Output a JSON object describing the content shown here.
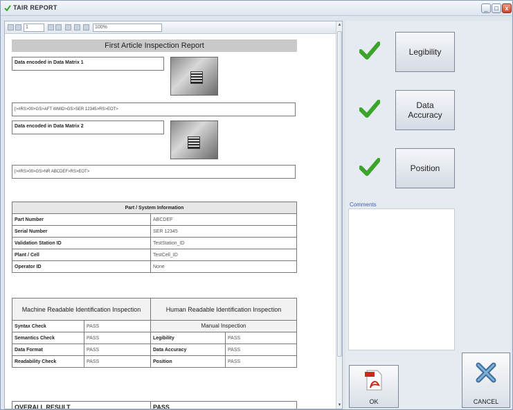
{
  "window": {
    "title": "TAIR REPORT"
  },
  "toolbar": {
    "page_field": "1",
    "zoom_field": "100%"
  },
  "report": {
    "title": "First Article Inspection Report",
    "matrix1": {
      "label": "Data encoded in Data Matrix 1",
      "data": "[>#RS>00>GS>AFT WMID>GS>SER 12345>RS>EOT>"
    },
    "matrix2": {
      "label": "Data encoded in Data Matrix 2",
      "data": "[>#RS>00>GS>NR ABCDEF>RS>EOT>"
    },
    "part_info": {
      "heading": "Part / System Information",
      "rows": [
        {
          "label": "Part Number",
          "value": "ABCDEF"
        },
        {
          "label": "Serial Number",
          "value": "SER 12345"
        },
        {
          "label": "Validation Station ID",
          "value": "TestStation_ID"
        },
        {
          "label": "Plant / Cell",
          "value": "TestCell_ID"
        },
        {
          "label": "Operator ID",
          "value": "None"
        }
      ]
    },
    "inspection": {
      "machine_heading": "Machine Readable Identification Inspection",
      "human_heading": "Human Readable Identification Inspection",
      "manual_heading": "Manual Inspection",
      "machine_rows": [
        {
          "label": "Syntax Check",
          "value": "PASS"
        },
        {
          "label": "Semantics Check",
          "value": "PASS"
        },
        {
          "label": "Data Format",
          "value": "PASS"
        },
        {
          "label": "Readability Check",
          "value": "PASS"
        }
      ],
      "human_rows": [
        {
          "label": "Legibility",
          "value": "PASS"
        },
        {
          "label": "Data Accuracy",
          "value": "PASS"
        },
        {
          "label": "Position",
          "value": "PASS"
        }
      ],
      "overall_label": "OVERALL RESULT",
      "overall_value": "PASS"
    }
  },
  "panel": {
    "checks": [
      {
        "label": "Legibility",
        "icon": "check-icon",
        "color": "#3aa52a"
      },
      {
        "label_line1": "Data",
        "label_line2": "Accuracy",
        "icon": "check-icon",
        "color": "#3aa52a"
      },
      {
        "label": "Position",
        "icon": "check-icon",
        "color": "#3aa52a"
      }
    ],
    "comments_label": "Comments",
    "ok_label": "OK",
    "cancel_label": "CANCEL"
  }
}
